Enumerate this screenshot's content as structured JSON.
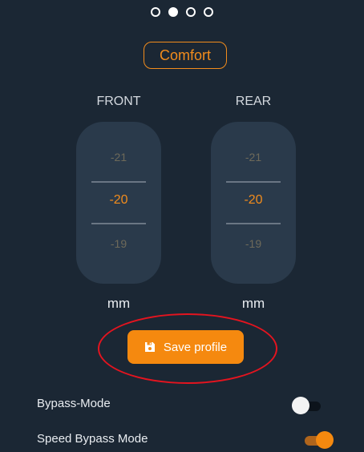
{
  "pager": {
    "count": 4,
    "active_index": 1
  },
  "profile": {
    "mode_label": "Comfort"
  },
  "front": {
    "label": "FRONT",
    "prev": "-21",
    "value": "-20",
    "next": "-19",
    "unit": "mm"
  },
  "rear": {
    "label": "REAR",
    "prev": "-21",
    "value": "-20",
    "next": "-19",
    "unit": "mm"
  },
  "actions": {
    "save_label": "Save profile",
    "save_icon": "floppy-disk-icon"
  },
  "settings": {
    "bypass_label": "Bypass-Mode",
    "bypass_on": false,
    "speed_bypass_label": "Speed Bypass Mode",
    "speed_bypass_on": true
  },
  "colors": {
    "accent": "#f5890f",
    "background": "#1b2734",
    "annotation": "#e4141f"
  }
}
